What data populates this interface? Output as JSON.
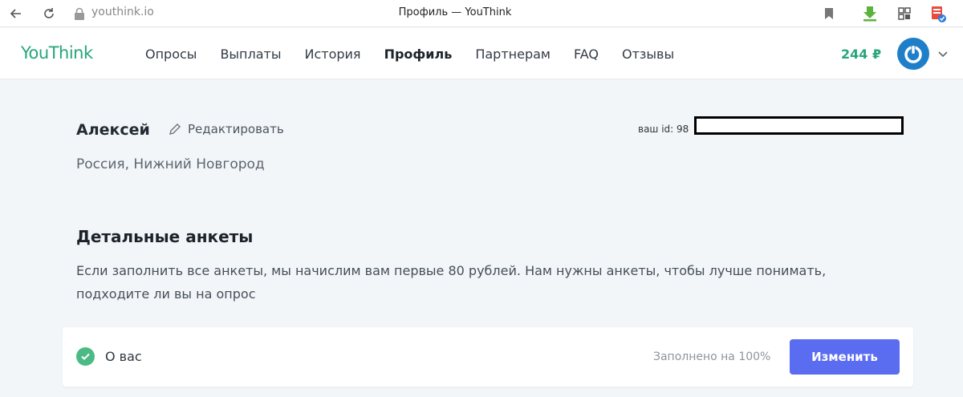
{
  "browser": {
    "url": "youthink.io",
    "tab_title": "Профиль — YouThink"
  },
  "header": {
    "logo": "YouThink",
    "menu": [
      {
        "label": "Опросы",
        "active": false
      },
      {
        "label": "Выплаты",
        "active": false
      },
      {
        "label": "История",
        "active": false
      },
      {
        "label": "Профиль",
        "active": true
      },
      {
        "label": "Партнерам",
        "active": false
      },
      {
        "label": "FAQ",
        "active": false
      },
      {
        "label": "Отзывы",
        "active": false
      }
    ],
    "balance": "244 ₽"
  },
  "profile": {
    "name": "Алексей",
    "edit_label": "Редактировать",
    "id_label": "ваш id: 98",
    "location": "Россия, Нижний Новгород"
  },
  "questionnaires": {
    "title": "Детальные анкеты",
    "description": "Если заполнить все анкеты, мы начислим вам первые 80 рублей. Нам нужны анкеты, чтобы лучше понимать, подходите ли вы на опрос",
    "items": [
      {
        "label": "О вас",
        "progress": "Заполнено на 100%",
        "button": "Изменить"
      }
    ]
  },
  "colors": {
    "brand": "#27a67a",
    "accent_button": "#5a6cf0",
    "check": "#4cba84",
    "avatar": "#1e7fc8"
  },
  "icons": [
    "back-arrow-icon",
    "reload-icon",
    "lock-icon",
    "bookmark-icon",
    "download-arrow-icon",
    "extension-icon",
    "pdf-extension-icon",
    "pencil-icon",
    "power-icon",
    "chevron-down-icon",
    "check-circle-icon"
  ]
}
